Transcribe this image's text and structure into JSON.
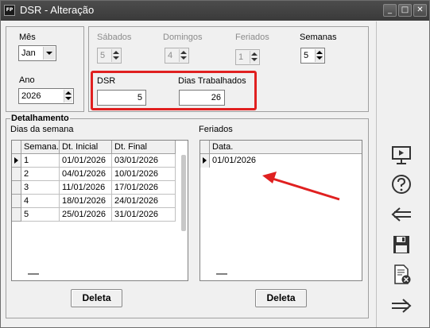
{
  "window": {
    "icon_text": "FP",
    "title": "DSR - Alteração",
    "controls": {
      "minimize": "_",
      "maximize": "□",
      "close": "✕"
    }
  },
  "header": {
    "mes_label": "Mês",
    "mes_value": "Jan",
    "ano_label": "Ano",
    "ano_value": "2026",
    "sabados_label": "Sábados",
    "sabados_value": "5",
    "domingos_label": "Domingos",
    "domingos_value": "4",
    "feriados_label": "Feriados",
    "feriados_value": "1",
    "semanas_label": "Semanas",
    "semanas_value": "5",
    "dsr_label": "DSR",
    "dsr_value": "5",
    "dias_trab_label": "Dias Trabalhados",
    "dias_trab_value": "26"
  },
  "detalhamento": {
    "title": "Detalhamento",
    "dias_semana_label": "Dias da semana",
    "feriados_label": "Feriados",
    "weeks_columns": [
      "Semana.",
      "Dt. Inicial",
      "Dt. Final"
    ],
    "weeks_rows": [
      {
        "semana": "1",
        "inicial": "01/01/2026",
        "final": "03/01/2026"
      },
      {
        "semana": "2",
        "inicial": "04/01/2026",
        "final": "10/01/2026"
      },
      {
        "semana": "3",
        "inicial": "11/01/2026",
        "final": "17/01/2026"
      },
      {
        "semana": "4",
        "inicial": "18/01/2026",
        "final": "24/01/2026"
      },
      {
        "semana": "5",
        "inicial": "25/01/2026",
        "final": "31/01/2026"
      }
    ],
    "holidays_columns": [
      "Data."
    ],
    "holidays_rows": [
      {
        "data": "01/01/2026"
      }
    ],
    "delete_weeks_label": "Deleta",
    "delete_holidays_label": "Deleta"
  },
  "sidebar": {
    "icons": [
      "monitor-icon",
      "help-icon",
      "back-arrow-icon",
      "save-icon",
      "cancel-document-icon",
      "forward-arrow-icon"
    ]
  },
  "colors": {
    "highlight_red": "#e02020",
    "titlebar": "#3f3f3f"
  }
}
